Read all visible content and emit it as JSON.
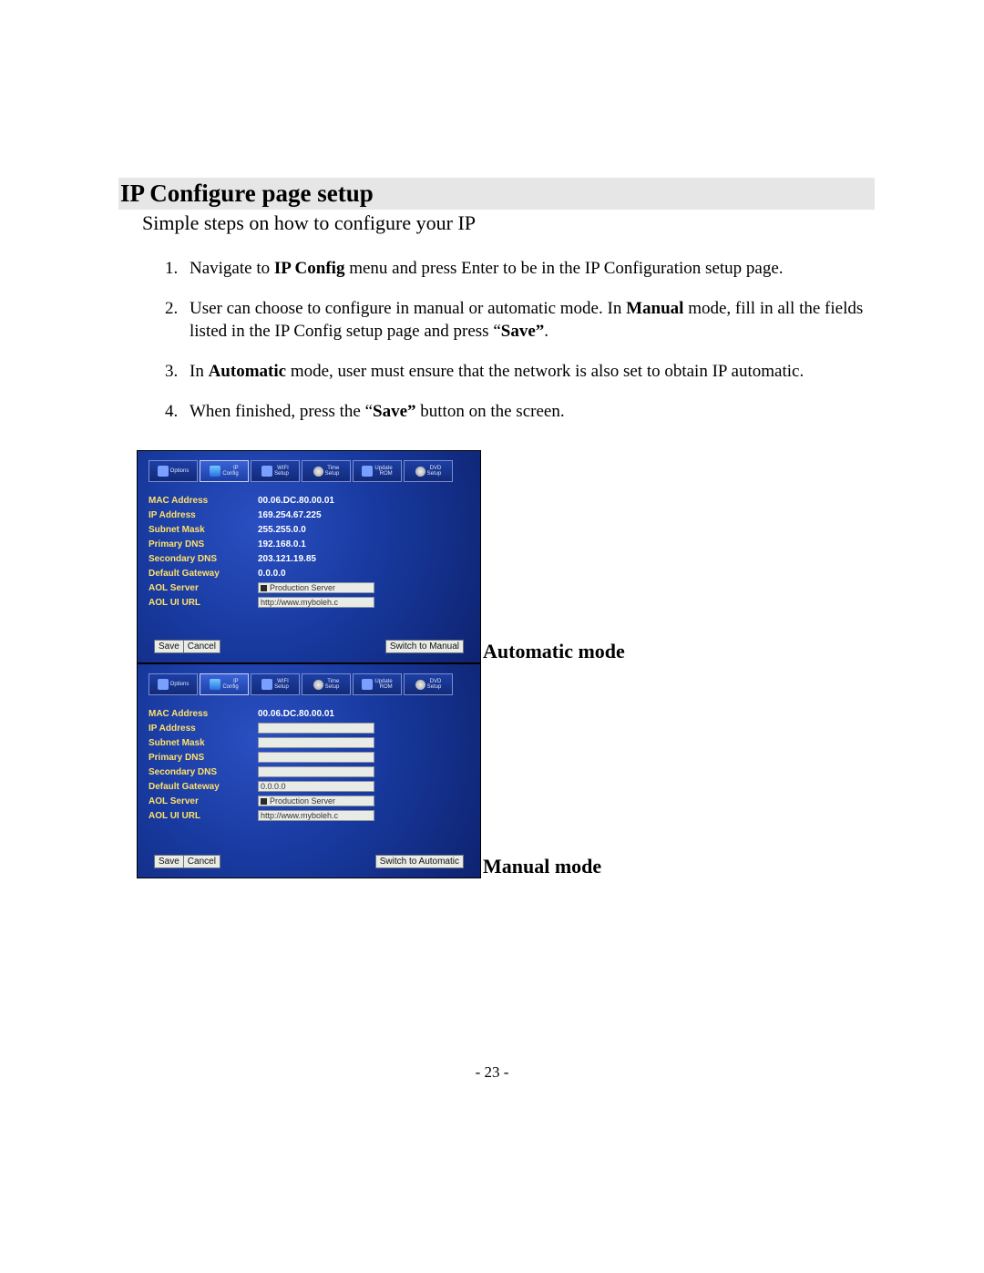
{
  "doc": {
    "title": "IP Configure page setup",
    "subtitle": "Simple steps on how to configure your IP",
    "page_number": "- 23 -"
  },
  "steps": {
    "s1_a": "Navigate to ",
    "s1_b": "IP Config",
    "s1_c": " menu and press Enter to be in the IP Configuration setup page.",
    "s2_a": "User can choose to configure in manual or automatic mode. In ",
    "s2_b": "Manual",
    "s2_c": " mode, fill in all the fields listed in the IP Config setup page and press “",
    "s2_d": "Save”",
    "s2_e": ".",
    "s3_a": "In ",
    "s3_b": "Automatic",
    "s3_c": " mode, user must ensure that the network is also set to obtain IP automatic.",
    "s4_a": "When finished, press the “",
    "s4_b": "Save”",
    "s4_c": " button on the screen."
  },
  "captions": {
    "auto": "Automatic mode",
    "manual": "Manual mode"
  },
  "tabs": {
    "options": "Options",
    "ipconfig": "IP\nConfig",
    "wifi": "WIFI\nSetup",
    "time": "Time\nSetup",
    "update": "Update\nROM",
    "dvd": "DVD\nSetup"
  },
  "labels": {
    "mac": "MAC Address",
    "ip": "IP Address",
    "subnet": "Subnet Mask",
    "pdns": "Primary DNS",
    "sdns": "Secondary DNS",
    "gateway": "Default Gateway",
    "aol_server": "AOL Server",
    "aol_url": "AOL UI URL"
  },
  "auto_values": {
    "mac": "00.06.DC.80.00.01",
    "ip": "169.254.67.225",
    "subnet": "255.255.0.0",
    "pdns": "192.168.0.1",
    "sdns": "203.121.19.85",
    "gateway": "0.0.0.0",
    "aol_server": "Production Server",
    "aol_url": "http://www.myboleh.c"
  },
  "manual_values": {
    "mac": "00.06.DC.80.00.01",
    "ip": "",
    "subnet": "",
    "pdns": "",
    "sdns": "",
    "gateway": "0.0.0.0",
    "aol_server": "Production Server",
    "aol_url": "http://www.myboleh.c"
  },
  "buttons": {
    "save": "Save",
    "cancel": "Cancel",
    "switch_manual": "Switch to Manual",
    "switch_auto": "Switch to Automatic"
  }
}
